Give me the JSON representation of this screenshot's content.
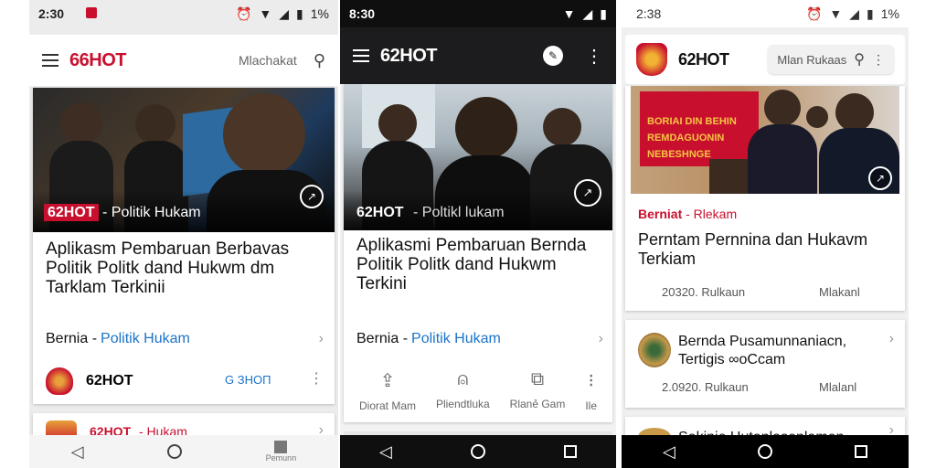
{
  "phone1": {
    "status": {
      "time": "2:30",
      "battery": "1%"
    },
    "brand": "66HOT",
    "search_placeholder": "Mlachakat",
    "hero_tag_brand": "62HOT",
    "hero_tag_section": "- Politik Hukam",
    "headline": "Aplikasm Pembaruan Berbavas Politik Politk dand Hukwm dm Tarklam Terkinii",
    "section_prefix": "Bernia - ",
    "section_link": "Politik Hukam",
    "source_name": "62HOT",
    "source_chip": "G ЗНОП",
    "next_tag_brand": "62HOT",
    "next_tag_section": "- Hukam",
    "nav_label": "Pemunn"
  },
  "phone2": {
    "status": {
      "time": "8:30"
    },
    "brand": "62HOT",
    "hero_tag_brand": "62HOT",
    "hero_tag_section": "- Poltikl lukam",
    "headline": "Aplikasmi Pembaruan Bernda Politik Politk dand Hukwm Terkini",
    "section_prefix": "Bernia - ",
    "section_link": "Politik Hukam",
    "actions": [
      "Diorat Mam",
      "Pliendtluka",
      "Rlanẻ Gam"
    ],
    "action_more": "Ile"
  },
  "phone3": {
    "status": {
      "time": "2:38",
      "battery": "1%"
    },
    "brand": "62HOT",
    "search_placeholder": "Mlan Rukaas",
    "banner_text": "BORIAI DIN BEHIN\nREMDAGUONIN\nNEBESHNGE",
    "card1": {
      "tag_brand": "Berniat",
      "tag_section": "- Rlekam",
      "headline": "Perntam Pernnina dan Hukavm Terkiam",
      "date": "20320. Rulkaun",
      "read": "Mlakanl"
    },
    "card2": {
      "headline": "Bernda Pusamunnaniacn, Tertigis ∞oCcam",
      "date": "2.0920. Rulkaun",
      "read": "Mlalanl"
    },
    "card3": {
      "headline": "Sekinie Hutanlasenlamen"
    }
  },
  "colors": {
    "brand_red": "#c8102e",
    "link_blue": "#1a73c8",
    "dark_bar": "#1c1c1e"
  }
}
